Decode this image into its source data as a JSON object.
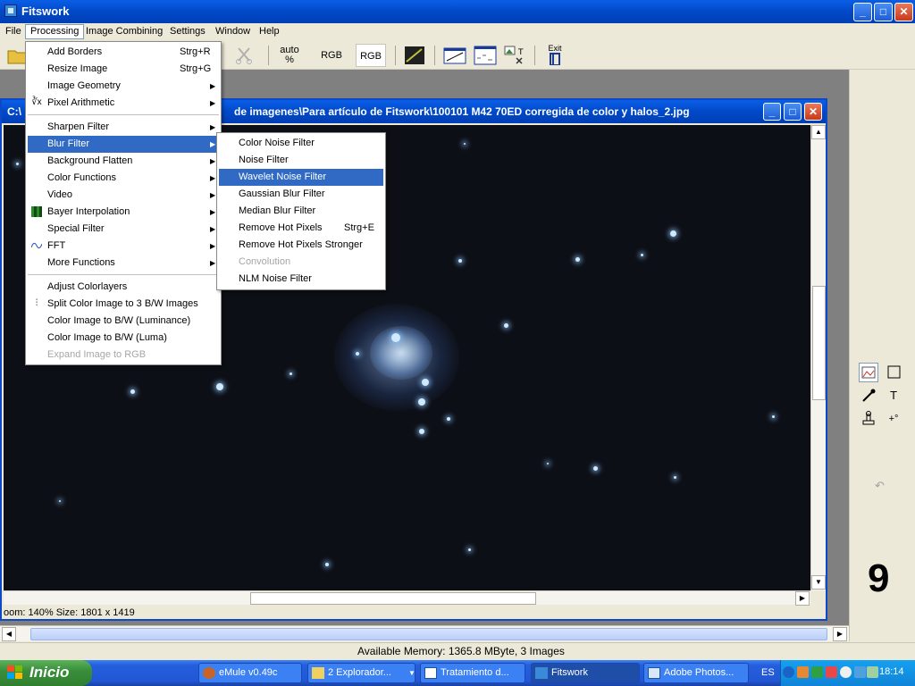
{
  "window": {
    "title": "Fitswork"
  },
  "menubar": [
    "File",
    "Processing",
    "Image Combining",
    "Settings",
    "Window",
    "Help"
  ],
  "toolbar": {
    "auto_label": "auto",
    "auto_sub": "%",
    "rgb1": "RGB",
    "rgb2": "RGB",
    "exit": "Exit"
  },
  "child": {
    "title": "C:\\...de imagenes\\Para artículo de Fitswork\\100101 M42 70ED corregida de color y halos_2.jpg",
    "title_left": "C:\\",
    "title_right": "de imagenes\\Para artículo de Fitswork\\100101 M42 70ED corregida de color y halos_2.jpg",
    "status": "oom: 140%    Size: 1801 x 1419"
  },
  "processing_menu": {
    "items": [
      {
        "label": "Add Borders",
        "shortcut": "Strg+R"
      },
      {
        "label": "Resize Image",
        "shortcut": "Strg+G"
      },
      {
        "label": "Image Geometry",
        "submenu": true
      },
      {
        "label": "Pixel Arithmetic",
        "submenu": true,
        "icon": "sqrt-icon"
      },
      {
        "label": "Sharpen Filter",
        "submenu": true
      },
      {
        "label": "Blur Filter",
        "submenu": true,
        "highlighted": true
      },
      {
        "label": "Background Flatten",
        "submenu": true
      },
      {
        "label": "Color Functions",
        "submenu": true
      },
      {
        "label": "Video",
        "submenu": true
      },
      {
        "label": "Bayer Interpolation",
        "submenu": true,
        "icon": "bayer-icon"
      },
      {
        "label": "Special Filter",
        "submenu": true
      },
      {
        "label": "FFT",
        "submenu": true,
        "icon": "fft-icon"
      },
      {
        "label": "More Functions",
        "submenu": true
      },
      {
        "label": "Adjust Colorlayers"
      },
      {
        "label": "Split Color Image to 3 B/W Images",
        "icon": "split-icon"
      },
      {
        "label": "Color Image to B/W (Luminance)"
      },
      {
        "label": "Color Image to B/W (Luma)"
      },
      {
        "label": "Expand Image to RGB",
        "disabled": true
      }
    ]
  },
  "blur_menu": {
    "items": [
      {
        "label": "Color Noise Filter"
      },
      {
        "label": "Noise Filter"
      },
      {
        "label": "Wavelet Noise Filter",
        "highlighted": true
      },
      {
        "label": "Gaussian Blur Filter"
      },
      {
        "label": "Median Blur Filter"
      },
      {
        "label": "Remove Hot Pixels",
        "shortcut": "Strg+E"
      },
      {
        "label": "Remove Hot Pixels Stronger"
      },
      {
        "label": "Convolution",
        "disabled": true
      },
      {
        "label": "NLM Noise Filter"
      }
    ]
  },
  "right_panel": {
    "number": "9",
    "undo": "↶"
  },
  "status": {
    "memory": "Available Memory: 1365.8 MByte, 3 Images"
  },
  "taskbar": {
    "start": "Inicio",
    "tasks": [
      "eMule v0.49c",
      "2 Explorador...",
      "Tratamiento d...",
      "Fitswork",
      "Adobe Photos..."
    ],
    "lang": "ES",
    "clock": "18:14"
  },
  "colors": {
    "accent": "#316ac5",
    "titlebar": "#0148c8",
    "sky": "#0d0f16"
  }
}
